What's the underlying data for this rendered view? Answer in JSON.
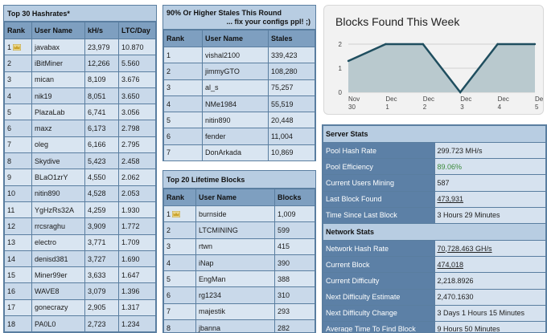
{
  "hashrates": {
    "title": "Top 30 Hashrates*",
    "columns": [
      "Rank",
      "User Name",
      "kH/s",
      "LTC/Day"
    ],
    "rows": [
      [
        "1",
        "javabax",
        "23,979",
        "10.870"
      ],
      [
        "2",
        "iBitMiner",
        "12,266",
        "5.560"
      ],
      [
        "3",
        "mican",
        "8,109",
        "3.676"
      ],
      [
        "4",
        "nik19",
        "8,051",
        "3.650"
      ],
      [
        "5",
        "PlazaLab",
        "6,741",
        "3.056"
      ],
      [
        "6",
        "maxz",
        "6,173",
        "2.798"
      ],
      [
        "7",
        "oleg",
        "6,166",
        "2.795"
      ],
      [
        "8",
        "Skydive",
        "5,423",
        "2.458"
      ],
      [
        "9",
        "BLaO1zrY",
        "4,550",
        "2.062"
      ],
      [
        "10",
        "nitin890",
        "4,528",
        "2.053"
      ],
      [
        "11",
        "YgHzRs32A",
        "4,259",
        "1.930"
      ],
      [
        "12",
        "rrcsraghu",
        "3,909",
        "1.772"
      ],
      [
        "13",
        "electro",
        "3,771",
        "1.709"
      ],
      [
        "14",
        "denisd381",
        "3,727",
        "1.690"
      ],
      [
        "15",
        "Miner99er",
        "3,633",
        "1.647"
      ],
      [
        "16",
        "WAVE8",
        "3,079",
        "1.396"
      ],
      [
        "17",
        "gonecrazy",
        "2,905",
        "1.317"
      ],
      [
        "18",
        "PA0L0",
        "2,723",
        "1.234"
      ]
    ]
  },
  "stales": {
    "title_line1": "90% Or Higher Stales This Round",
    "title_line2": "... fix your configs ppl! ;)",
    "columns": [
      "Rank",
      "User Name",
      "Stales"
    ],
    "rows": [
      [
        "1",
        "vishal2100",
        "339,423"
      ],
      [
        "2",
        "jimmyGTO",
        "108,280"
      ],
      [
        "3",
        "al_s",
        "75,257"
      ],
      [
        "4",
        "NMe1984",
        "55,519"
      ],
      [
        "5",
        "nitin890",
        "20,448"
      ],
      [
        "6",
        "fender",
        "11,004"
      ],
      [
        "7",
        "DonArkada",
        "10,869"
      ]
    ]
  },
  "lifetime": {
    "title": "Top 20 Lifetime Blocks",
    "columns": [
      "Rank",
      "User Name",
      "Blocks"
    ],
    "rows": [
      [
        "1",
        "burnside",
        "1,009"
      ],
      [
        "2",
        "LTCMINING",
        "599"
      ],
      [
        "3",
        "rtwn",
        "415"
      ],
      [
        "4",
        "iNap",
        "390"
      ],
      [
        "5",
        "EngMan",
        "388"
      ],
      [
        "6",
        "rg1234",
        "310"
      ],
      [
        "7",
        "majestik",
        "293"
      ],
      [
        "8",
        "jbanna",
        "282"
      ]
    ]
  },
  "chart_data": {
    "type": "area",
    "title": "Blocks Found This Week",
    "categories": [
      "Nov 30",
      "Dec 1",
      "Dec 2",
      "Dec 3",
      "Dec 4",
      "Dec 5"
    ],
    "x_labels": [
      [
        "Nov",
        "30"
      ],
      [
        "Dec",
        "1"
      ],
      [
        "Dec",
        "2"
      ],
      [
        "Dec",
        "3"
      ],
      [
        "Dec",
        "4"
      ],
      [
        "Dec",
        "5"
      ]
    ],
    "values": [
      1.3,
      2,
      2,
      0,
      2,
      2
    ],
    "ylim": [
      0,
      2
    ],
    "yticks": [
      "0",
      "1",
      "2"
    ],
    "grid": true,
    "line_color": "#1f4e5f",
    "fill_color": "#b9c9ce"
  },
  "server_stats": {
    "title": "Server Stats",
    "rows": [
      {
        "label": "Pool Hash Rate",
        "value": "299.723 MH/s",
        "style": ""
      },
      {
        "label": "Pool Efficiency",
        "value": "89.06%",
        "style": "green"
      },
      {
        "label": "Current Users Mining",
        "value": "587",
        "style": ""
      },
      {
        "label": "Last Block Found",
        "value": "473,931",
        "style": "link"
      },
      {
        "label": "Time Since Last Block",
        "value": "3 Hours 29 Minutes",
        "style": ""
      }
    ]
  },
  "network_stats": {
    "title": "Network Stats",
    "rows": [
      {
        "label": "Network Hash Rate",
        "value": "70,728.463 GH/s",
        "style": "link"
      },
      {
        "label": "Current Block",
        "value": "474,018",
        "style": "link"
      },
      {
        "label": "Current Difficulty",
        "value": "2,218.8926",
        "style": ""
      },
      {
        "label": "Next Difficulty Estimate",
        "value": "2,470.1630",
        "style": ""
      },
      {
        "label": "Next Difficulty Change",
        "value": "3 Days 1 Hours 15 Minutes",
        "style": ""
      },
      {
        "label": "Average Time To Find Block",
        "value": "9 Hours 50 Minutes",
        "style": ""
      }
    ]
  },
  "colors": {
    "panel_border": "#5a7ea0",
    "header_bg": "#7e9fc0",
    "label_bg": "#5c80a6",
    "green_text": "#3b8a3b"
  }
}
